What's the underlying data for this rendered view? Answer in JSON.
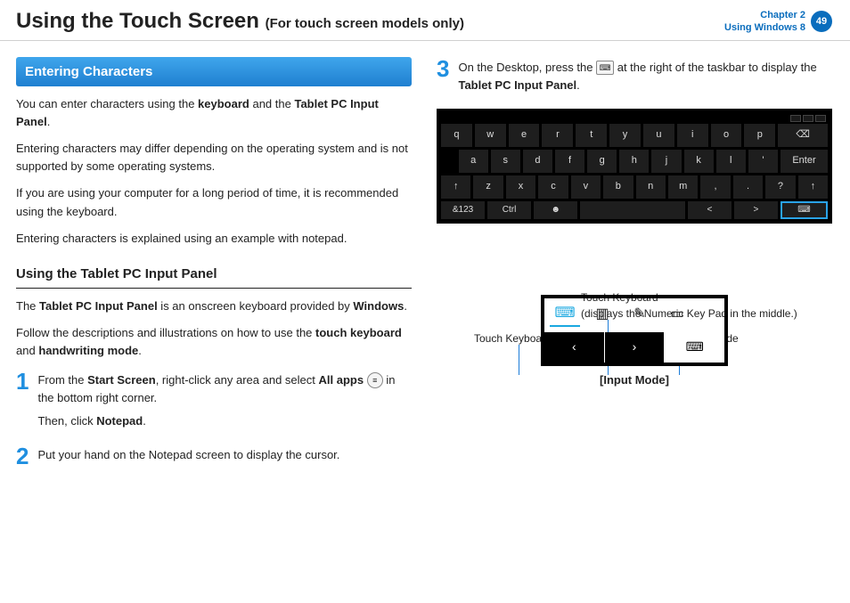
{
  "header": {
    "title": "Using the Touch Screen",
    "subtitle": "(For touch screen models only)",
    "chapter_line1": "Chapter 2",
    "chapter_line2": "Using Windows 8",
    "page": "49"
  },
  "left": {
    "banner": "Entering Characters",
    "p1_a": "You can enter characters using the ",
    "p1_b": "keyboard",
    "p1_c": " and the ",
    "p1_d": "Tablet PC Input Panel",
    "p1_e": ".",
    "p2": "Entering characters may differ depending on the operating system and is not supported by some operating systems.",
    "p3": "If you are using your computer for a long period of time, it is recommended using the keyboard.",
    "p4": "Entering characters is explained using an example with notepad.",
    "sect": "Using the Tablet PC Input Panel",
    "p5_a": "The ",
    "p5_b": "Tablet PC Input Panel",
    "p5_c": " is an onscreen keyboard provided by ",
    "p5_d": "Windows",
    "p5_e": ".",
    "p6_a": "Follow the descriptions and illustrations on how to use the ",
    "p6_b": "touch keyboard",
    "p6_c": " and ",
    "p6_d": "handwriting mode",
    "p6_e": ".",
    "step1_num": "1",
    "step1_a": "From the ",
    "step1_b": "Start Screen",
    "step1_c": ", right-click any area and select ",
    "step1_d": "All apps",
    "step1_e": " in the bottom right corner.",
    "step1_f": "Then, click ",
    "step1_g": "Notepad",
    "step1_h": ".",
    "step2_num": "2",
    "step2": "Put your hand on the Notepad screen to display the cursor."
  },
  "right": {
    "step3_num": "3",
    "step3_a": "On the Desktop, press the ",
    "step3_b": " at the right of the taskbar to display the ",
    "step3_c": "Tablet PC Input Panel",
    "step3_d": ".",
    "kbd": {
      "row1": [
        "q",
        "w",
        "e",
        "r",
        "t",
        "y",
        "u",
        "i",
        "o",
        "p",
        "⌫"
      ],
      "row2": [
        "a",
        "s",
        "d",
        "f",
        "g",
        "h",
        "j",
        "k",
        "l",
        "'",
        "Enter"
      ],
      "row3": [
        "↑",
        "z",
        "x",
        "c",
        "v",
        "b",
        "n",
        "m",
        ",",
        ".",
        "?",
        "↑"
      ],
      "row4": [
        "&123",
        "Ctrl",
        "☻",
        " ",
        "<",
        ">",
        "⌨"
      ]
    },
    "ann": {
      "l1": "Touch Keyboard",
      "l2_a": "Touch Keyboard",
      "l2_b": "(displays the Numeric Key Pad in the middle.)",
      "l3": "Handwriting Mode"
    },
    "caption": "[Input Mode]"
  }
}
